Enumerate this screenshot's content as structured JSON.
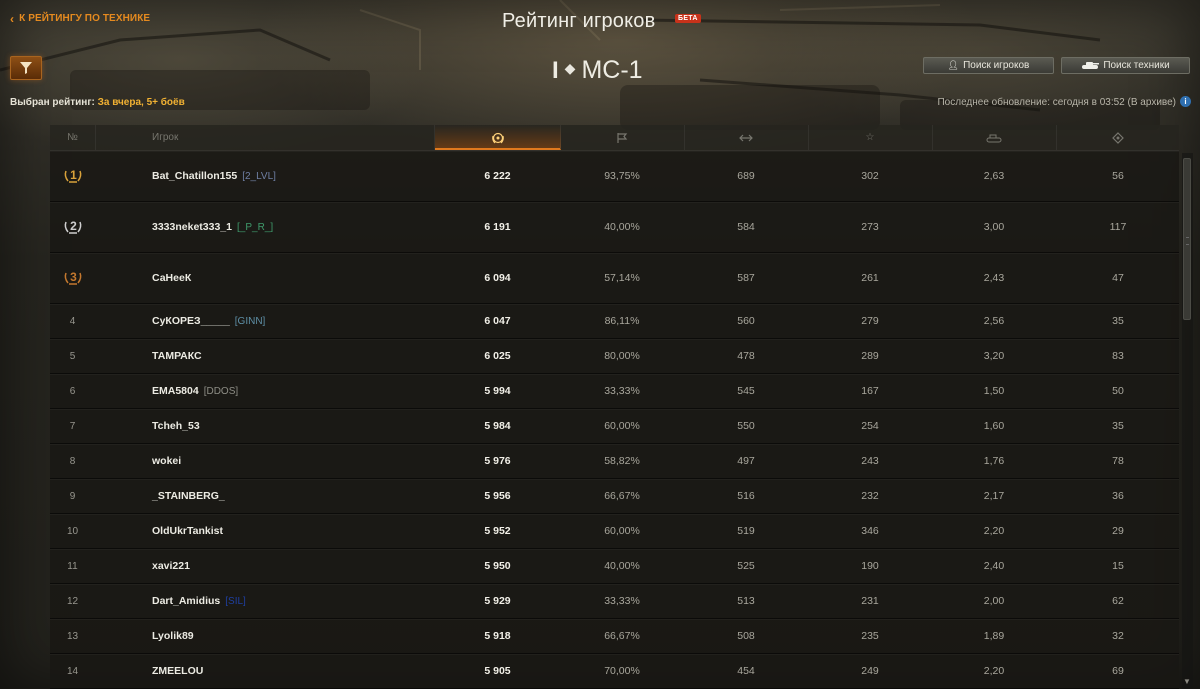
{
  "header": {
    "back_label": "К РЕЙТИНГУ ПО ТЕХНИКЕ",
    "title": "Рейтинг игроков",
    "beta_label": "БЕТА"
  },
  "filter": {
    "icon": "filter-icon",
    "selected_label": "Выбран рейтинг:",
    "selected_value": "За вчера, 5+ боёв"
  },
  "vehicle": {
    "tier": "I",
    "type_icon": "light-tank-icon",
    "name": "МС-1"
  },
  "buttons": {
    "players_label": "Поиск игроков",
    "players_icon": "user-icon",
    "vehicles_label": "Поиск техники",
    "vehicles_icon": "tank-icon"
  },
  "updated_text": "Последнее обновление: сегодня в 03:52 (В архиве)",
  "table": {
    "headers": {
      "rank": "№",
      "player": "Игрок",
      "score_icon": "rating-laurel-icon",
      "col_icons": [
        "battles-flag-icon",
        "damage-icon",
        "experience-star-icon",
        "kills-tank-icon",
        "spotting-icon"
      ]
    },
    "rows": [
      {
        "rank": "1",
        "player": "Bat_Chatillon155",
        "clan": "[2_LVL]",
        "clan_color": "#6f7fa3",
        "score": "6 222",
        "c1": "93,75%",
        "c2": "689",
        "c3": "302",
        "c4": "2,63",
        "c5": "56"
      },
      {
        "rank": "2",
        "player": "3333neket333_1",
        "clan": "[_P_R_]",
        "clan_color": "#3f9a6b",
        "score": "6 191",
        "c1": "40,00%",
        "c2": "584",
        "c3": "273",
        "c4": "3,00",
        "c5": "117"
      },
      {
        "rank": "3",
        "player": "СаНееК",
        "clan": "",
        "clan_color": "",
        "score": "6 094",
        "c1": "57,14%",
        "c2": "587",
        "c3": "261",
        "c4": "2,43",
        "c5": "47"
      },
      {
        "rank": "4",
        "player": "СуКОРЕЗ_____",
        "clan": "[GINN]",
        "clan_color": "#5e8fa6",
        "score": "6 047",
        "c1": "86,11%",
        "c2": "560",
        "c3": "279",
        "c4": "2,56",
        "c5": "35"
      },
      {
        "rank": "5",
        "player": "ТАМРАКС",
        "clan": "",
        "clan_color": "",
        "score": "6 025",
        "c1": "80,00%",
        "c2": "478",
        "c3": "289",
        "c4": "3,20",
        "c5": "83"
      },
      {
        "rank": "6",
        "player": "EMA5804",
        "clan": "[DDOS]",
        "clan_color": "#8e8e86",
        "score": "5 994",
        "c1": "33,33%",
        "c2": "545",
        "c3": "167",
        "c4": "1,50",
        "c5": "50"
      },
      {
        "rank": "7",
        "player": "Tcheh_53",
        "clan": "",
        "clan_color": "",
        "score": "5 984",
        "c1": "60,00%",
        "c2": "550",
        "c3": "254",
        "c4": "1,60",
        "c5": "35"
      },
      {
        "rank": "8",
        "player": "wokei",
        "clan": "",
        "clan_color": "",
        "score": "5 976",
        "c1": "58,82%",
        "c2": "497",
        "c3": "243",
        "c4": "1,76",
        "c5": "78"
      },
      {
        "rank": "9",
        "player": "_STAINBERG_",
        "clan": "",
        "clan_color": "",
        "score": "5 956",
        "c1": "66,67%",
        "c2": "516",
        "c3": "232",
        "c4": "2,17",
        "c5": "36"
      },
      {
        "rank": "10",
        "player": "OldUkrTankist",
        "clan": "",
        "clan_color": "",
        "score": "5 952",
        "c1": "60,00%",
        "c2": "519",
        "c3": "346",
        "c4": "2,20",
        "c5": "29"
      },
      {
        "rank": "11",
        "player": "xavi221",
        "clan": "",
        "clan_color": "",
        "score": "5 950",
        "c1": "40,00%",
        "c2": "525",
        "c3": "190",
        "c4": "2,40",
        "c5": "15"
      },
      {
        "rank": "12",
        "player": "Dart_Amidius",
        "clan": "[SIL]",
        "clan_color": "#1f3fa0",
        "score": "5 929",
        "c1": "33,33%",
        "c2": "513",
        "c3": "231",
        "c4": "2,00",
        "c5": "62"
      },
      {
        "rank": "13",
        "player": "Lyolik89",
        "clan": "",
        "clan_color": "",
        "score": "5 918",
        "c1": "66,67%",
        "c2": "508",
        "c3": "235",
        "c4": "1,89",
        "c5": "32"
      },
      {
        "rank": "14",
        "player": "ZMEELOU",
        "clan": "",
        "clan_color": "",
        "score": "5 905",
        "c1": "70,00%",
        "c2": "454",
        "c3": "249",
        "c4": "2,20",
        "c5": "69"
      }
    ]
  },
  "colors": {
    "accent": "#e58a1f",
    "gold": "#d9a23a",
    "silver": "#cfcfcf",
    "bronze": "#c4782e",
    "info": "#2f6fb0"
  }
}
